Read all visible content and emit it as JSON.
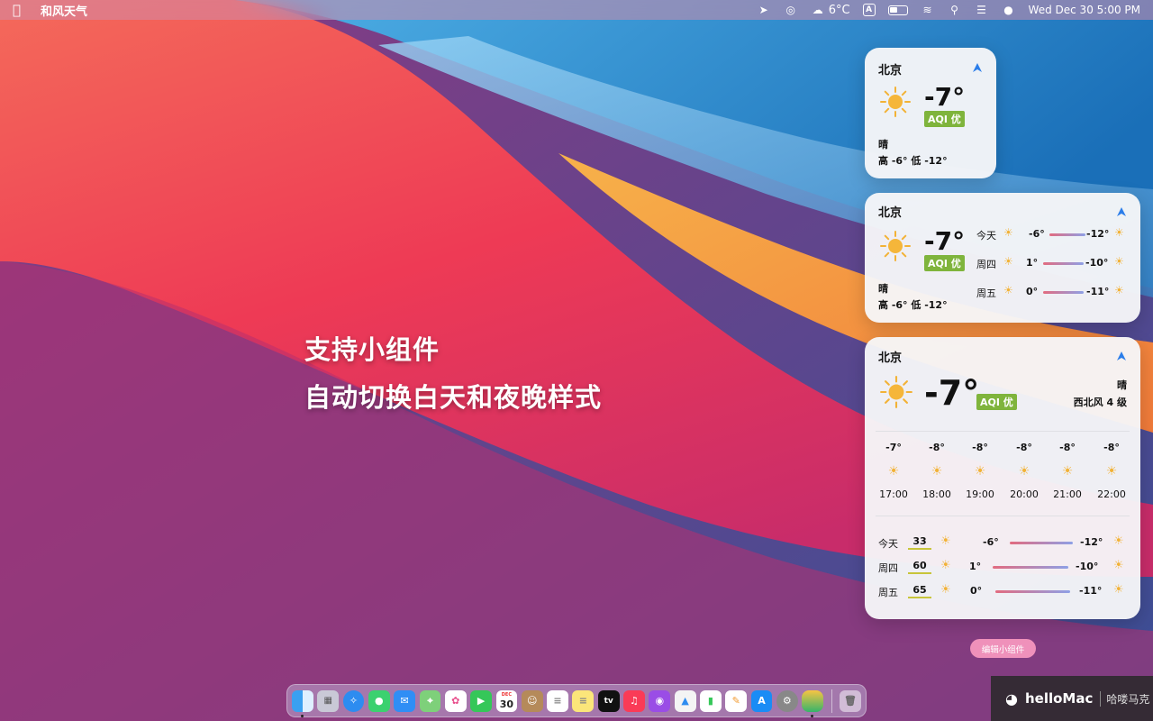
{
  "menubar": {
    "app_name": "和风天气",
    "weather_temp": "6°C",
    "input_method": "A",
    "datetime": "Wed Dec 30  5:00 PM"
  },
  "promo": {
    "line1": "支持小组件",
    "line2": "自动切换白天和夜晚样式"
  },
  "small_widget": {
    "city": "北京",
    "temp": "-7°",
    "aqi": "AQI 优",
    "condition": "晴",
    "high_low": "高 -6°  低 -12°"
  },
  "medium_widget": {
    "city": "北京",
    "temp": "-7°",
    "aqi": "AQI 优",
    "condition": "晴",
    "high_low": "高 -6°  低 -12°",
    "forecast": [
      {
        "day": "今天",
        "high": "-6°",
        "low": "-12°"
      },
      {
        "day": "周四",
        "high": "1°",
        "low": "-10°"
      },
      {
        "day": "周五",
        "high": "0°",
        "low": "-11°"
      }
    ]
  },
  "large_widget": {
    "city": "北京",
    "temp": "-7°",
    "aqi": "AQI 优",
    "condition": "晴",
    "wind": "西北风 4 级",
    "hourly": [
      {
        "temp": "-7°",
        "time": "17:00"
      },
      {
        "temp": "-8°",
        "time": "18:00"
      },
      {
        "temp": "-8°",
        "time": "19:00"
      },
      {
        "temp": "-8°",
        "time": "20:00"
      },
      {
        "temp": "-8°",
        "time": "21:00"
      },
      {
        "temp": "-8°",
        "time": "22:00"
      }
    ],
    "daily": [
      {
        "day": "今天",
        "aqi": "33",
        "high": "-6°",
        "low": "-12°"
      },
      {
        "day": "周四",
        "aqi": "60",
        "high": "1°",
        "low": "-10°"
      },
      {
        "day": "周五",
        "aqi": "65",
        "high": "0°",
        "low": "-11°"
      }
    ]
  },
  "edit_widgets_label": "编辑小组件",
  "dock": {
    "calendar_day": "30",
    "calendar_month": "DEC",
    "tv_label": "tv"
  },
  "watermark": {
    "brand": "helloMac",
    "sub": "哈喽马克"
  }
}
